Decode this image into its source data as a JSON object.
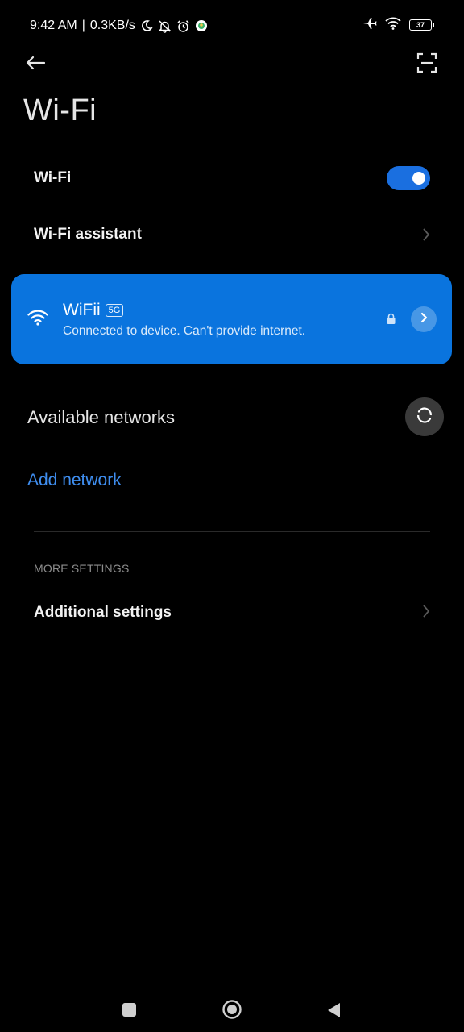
{
  "status_bar": {
    "time": "9:42 AM",
    "separator": "|",
    "speed": "0.3KB/s",
    "battery_level": "37",
    "icons": [
      "moon-icon",
      "bell-off-icon",
      "alarm-icon",
      "app-notification-icon",
      "airplane-icon",
      "wifi-status-icon",
      "battery-icon"
    ]
  },
  "header": {
    "title": "Wi-Fi",
    "icons": [
      "back-arrow-icon",
      "scan-qr-icon"
    ]
  },
  "settings": {
    "wifi_label": "Wi-Fi",
    "wifi_enabled": true,
    "assistant_label": "Wi-Fi assistant"
  },
  "connected_network": {
    "name": "WiFii",
    "band": "5G",
    "status": "Connected to device. Can't provide internet.",
    "icons": [
      "wifi-signal-icon",
      "lock-icon",
      "chevron-right-icon"
    ]
  },
  "available": {
    "label": "Available networks",
    "add_network": "Add network",
    "icons": [
      "refresh-icon"
    ]
  },
  "more_settings": {
    "header": "MORE SETTINGS",
    "additional_label": "Additional settings"
  },
  "colors": {
    "accent": "#0a74de",
    "toggle_on": "#1a6fe0",
    "link": "#3f8ef0",
    "background": "#000000"
  },
  "nav_bar": {
    "icons": [
      "recent-apps-icon",
      "home-icon",
      "back-icon"
    ]
  }
}
